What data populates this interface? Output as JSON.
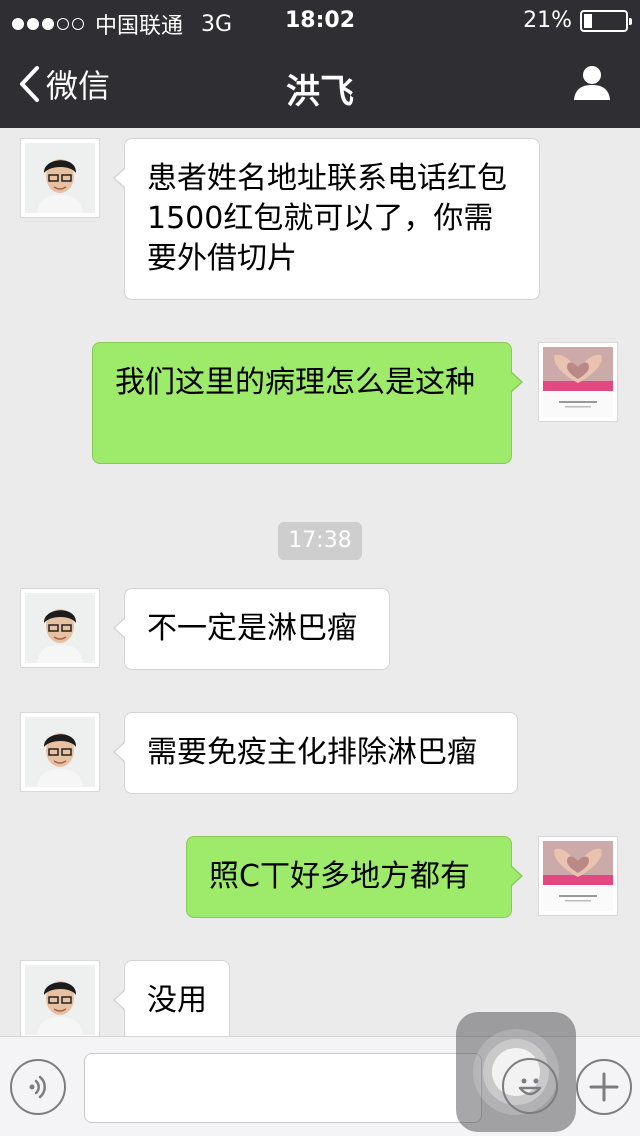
{
  "status_bar": {
    "carrier": "中国联通",
    "network": "3G",
    "time": "18:02",
    "battery_percent": "21%",
    "battery_level": 0.21
  },
  "nav": {
    "back_label": "微信",
    "title": "洪飞"
  },
  "messages": [
    {
      "direction": "in",
      "text": "患者姓名地址联系电话红包1500红包就可以了，你需要外借切片"
    },
    {
      "direction": "out",
      "text": "我们这里的病理怎么是这种"
    },
    {
      "direction": "in",
      "text": "不一定是淋巴瘤"
    },
    {
      "direction": "in",
      "text": "需要免疫主化排除淋巴瘤"
    },
    {
      "direction": "out",
      "text": "照C丅好多地方都有"
    },
    {
      "direction": "in",
      "text": "没用"
    }
  ],
  "timestamp": "17:38",
  "input_bar": {
    "message_value": "",
    "icons": [
      "voice-icon",
      "emoji-icon",
      "plus-icon"
    ]
  },
  "colors": {
    "nav_bg": "#2e2e33",
    "chat_bg": "#ebebeb",
    "outgoing_bubble": "#9eea6a",
    "incoming_bubble": "#ffffff"
  }
}
